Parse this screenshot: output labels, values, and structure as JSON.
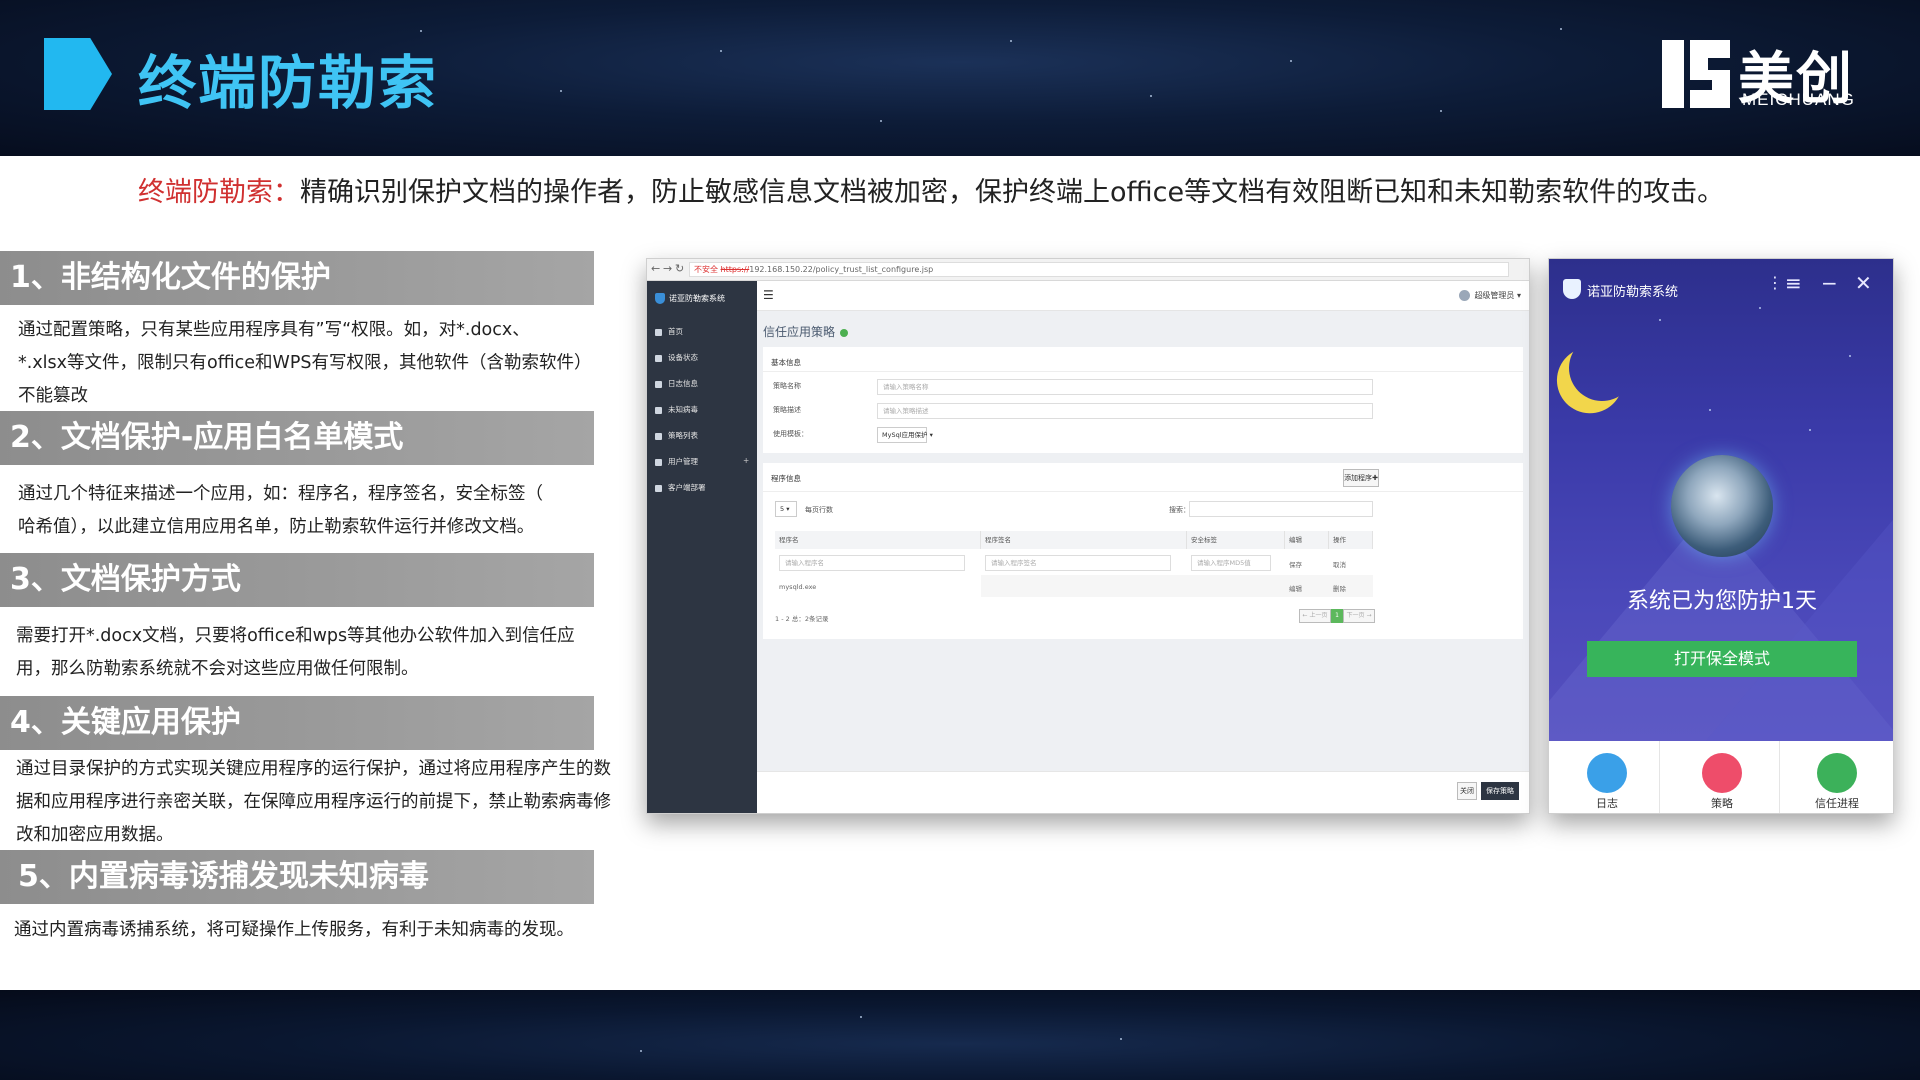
{
  "header": {
    "title": "终端防勒索",
    "logo_cn": "美创",
    "logo_en": "MEICHUANG"
  },
  "intro": {
    "lead": "终端防勒索：",
    "text": "精确识别保护文档的操作者，防止敏感信息文档被加密，保护终端上office等文档有效阻断已知和未知勒索软件的攻击。"
  },
  "sections": [
    {
      "title": "1、非结构化文件的保护",
      "lines": [
        "通过配置策略，只有某些应用程序具有”写“权限。如，对*.docx、",
        "*.xlsx等文件，限制只有office和WPS有写权限，其他软件（含勒索软件）",
        "不能篡改"
      ]
    },
    {
      "title": "2、文档保护-应用白名单模式",
      "lines": [
        "通过几个特征来描述一个应用，如：程序名，程序签名，安全标签（",
        "哈希值），以此建立信用应用名单，防止勒索软件运行并修改文档。"
      ]
    },
    {
      "title": "3、文档保护方式",
      "lines": [
        "需要打开*.docx文档，只要将office和wps等其他办公软件加入到信任应",
        "用，那么防勒索系统就不会对这些应用做任何限制。"
      ]
    },
    {
      "title": "4、关键应用保护",
      "lines": [
        "通过目录保护的方式实现关键应用程序的运行保护，通过将应用程序产生的数",
        "据和应用程序进行亲密关联，在保障应用程序运行的前提下，禁止勒索病毒修",
        "改和加密应用数据。"
      ]
    },
    {
      "title": "5、内置病毒诱捕发现未知病毒",
      "lines": [
        "通过内置病毒诱捕系统，将可疑操作上传服务，有利于未知病毒的发现。"
      ]
    }
  ],
  "browser": {
    "url_warning": "不安全",
    "url_scheme": "https://",
    "url": "192.168.150.22/policy_trust_list_configure.jsp",
    "brand": "诺亚防勒索系统",
    "menu": [
      "首页",
      "设备状态",
      "日志信息",
      "未知病毒",
      "策略列表",
      "用户管理",
      "客户端部署"
    ],
    "user": "超级管理员",
    "page_title": "信任应用策略",
    "basic": {
      "heading": "基本信息",
      "name_label": "策略名称",
      "name_placeholder": "请输入策略名称",
      "desc_label": "策略描述",
      "desc_placeholder": "请输入策略描述",
      "template_label": "使用模板：",
      "template_value": "MySql应用保护"
    },
    "program": {
      "heading": "程序信息",
      "add_button": "添加程序",
      "page_size": "5",
      "page_size_suffix": "每页行数",
      "search_label": "搜索：",
      "columns": [
        "程序名",
        "程序签名",
        "安全标签",
        "编辑",
        "操作"
      ],
      "filter_placeholders": [
        "请输入程序名",
        "请输入程序签名",
        "请输入程序MD5值"
      ],
      "filter_row_actions": [
        "保存",
        "取消"
      ],
      "row": {
        "name": "mysqld.exe",
        "edit": "编辑",
        "op": "删除"
      },
      "summary": "1 - 2 总：2条记录",
      "prev": "← 上一页",
      "page": "1",
      "next": "下一页 →"
    },
    "footer": {
      "close": "关闭",
      "save": "保存策略"
    }
  },
  "app": {
    "title": "诺亚防勒索系统",
    "status": "系统已为您防护1天",
    "button": "打开保全模式",
    "tabs": [
      "日志",
      "策略",
      "信任进程"
    ]
  },
  "colors": {
    "title_cyan": "#3fc4f4",
    "lead_red": "#d03030",
    "section_gray": "#999999",
    "app_green": "#37b45b"
  },
  "icons": [
    "title-chevron-icon",
    "meichuang-logo-icon",
    "search-icon",
    "menu-icon",
    "shield-icon",
    "moon-icon",
    "log-icon",
    "strategy-icon",
    "trust-process-icon"
  ]
}
